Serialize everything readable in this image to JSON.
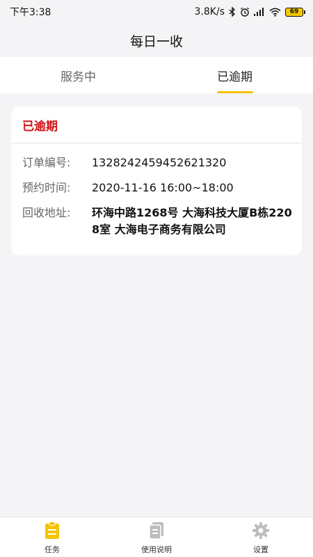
{
  "status_bar": {
    "time": "下午3:38",
    "network_speed": "3.8K/s",
    "battery": "69",
    "icons": [
      "bluetooth-icon",
      "alarm-icon",
      "signal-icon",
      "wifi-icon",
      "battery-icon"
    ]
  },
  "header": {
    "title": "每日一收"
  },
  "tabs": [
    {
      "label": "服务中",
      "active": false
    },
    {
      "label": "已逾期",
      "active": true
    }
  ],
  "order_card": {
    "status": "已逾期",
    "status_color": "#d0161a",
    "fields": [
      {
        "label": "订单编号:",
        "value": "1328242459452621320"
      },
      {
        "label": "预约时间:",
        "value": "2020-11-16 16:00~18:00"
      },
      {
        "label": "回收地址:",
        "value": "环海中路1268号 大海科技大厦B栋2208室 大海电子商务有限公司"
      }
    ]
  },
  "bottom_nav": [
    {
      "label": "任务",
      "icon": "clipboard-icon",
      "active": true,
      "color": "#f5c300"
    },
    {
      "label": "使用说明",
      "icon": "document-icon",
      "active": false,
      "color": "#bdbdbd"
    },
    {
      "label": "设置",
      "icon": "gear-icon",
      "active": false,
      "color": "#bdbdbd"
    }
  ],
  "colors": {
    "accent": "#f5c300",
    "overdue": "#d0161a",
    "background": "#f4f4f6"
  }
}
